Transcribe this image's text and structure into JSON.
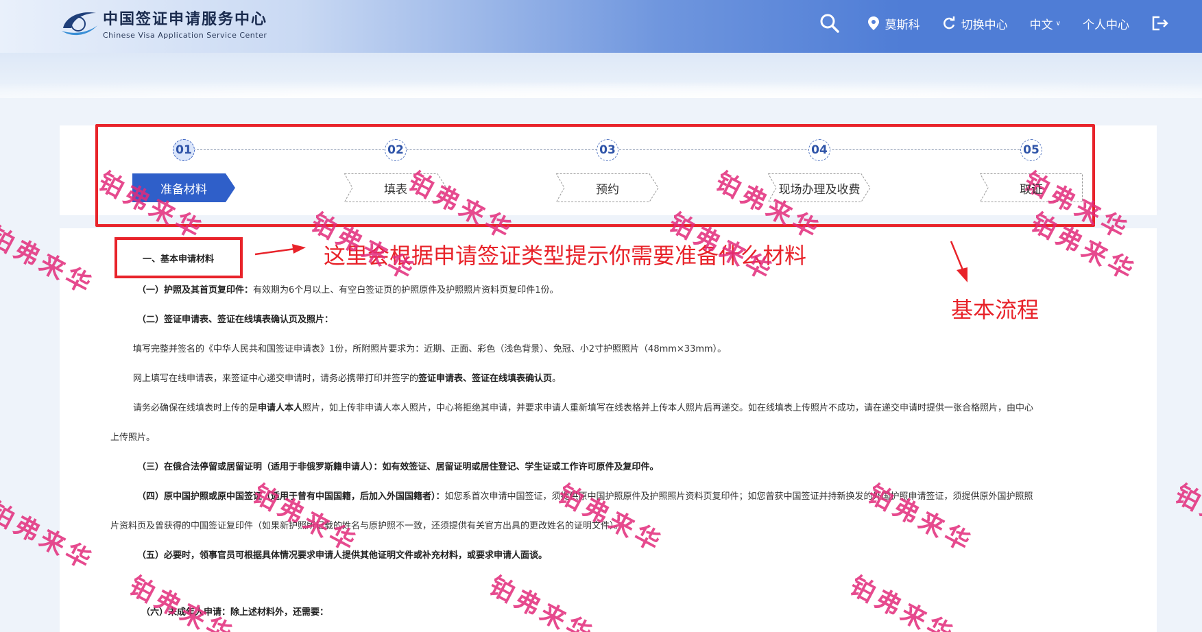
{
  "header": {
    "logo_cn": "中国签证申请服务中心",
    "logo_en": "Chinese Visa Application Service Center",
    "nav": {
      "location": "莫斯科",
      "switch_center": "切换中心",
      "language": "中文",
      "personal_center": "个人中心"
    }
  },
  "steps": [
    {
      "num": "01",
      "label": "准备材料",
      "active": true
    },
    {
      "num": "02",
      "label": "填表",
      "active": false
    },
    {
      "num": "03",
      "label": "预约",
      "active": false
    },
    {
      "num": "04",
      "label": "现场办理及收费",
      "active": false
    },
    {
      "num": "05",
      "label": "取证",
      "active": false
    }
  ],
  "content": {
    "section_title": "一、基本申请材料",
    "p1_bold": "（一）护照及其首页复印件：",
    "p1_text": "有效期为6个月以上、有空白签证页的护照原件及护照照片资料页复印件1份。",
    "p2_bold": "（二）签证申请表、签证在线填表确认页及照片：",
    "p3_text": "填写完整并签名的《中华人民共和国签证申请表》1份，所附照片要求为：近期、正面、彩色（浅色背景）、免冠、小2寸护照照片（48mm×33mm）。",
    "p4_pre": "网上填写在线申请表，来签证中心递交申请时，请务必携带打印并签字的",
    "p4_bold": "签证申请表、签证在线填表确认页",
    "p4_post": "。",
    "p5_pre": "请务必确保在线填表时上传的是",
    "p5_bold": "申请人本人",
    "p5_post": "照片，如上传非申请人本人照片，中心将拒绝其申请，并要求申请人重新填写在线表格并上传本人照片后再递交。如在线填表上传照片不成功，请在递交申请时提供一张合格照片，由中心",
    "p5_cont": "上传照片。",
    "p6_bold": "（三）在俄合法停留或居留证明（适用于非俄罗斯籍申请人）：如有效签证、居留证明或居住登记、学生证或工作许可原件及复印件。",
    "p7_bold": "（四）原中国护照或原中国签证（适用于曾有中国国籍，后加入外国国籍者）：",
    "p7_text": "如您系首次申请中国签证，须提供原中国护照原件及护照照片资料页复印件；如您曾获中国签证并持新换发的外国护照申请签证，须提供原外国护照照",
    "p7_cont": "片资料页及曾获得的中国签证复印件（如果新护照所记载的姓名与原护照不一致，还须提供有关官方出具的更改姓名的证明文件）。",
    "p8_bold": "（五）必要时，领事官员可根据具体情况要求申请人提供其他证明文件或补充材料，或要求申请人面谈。",
    "p9_bold": "（六）未成年人申请：除上述材料外，还需要："
  },
  "annotations": {
    "materials_hint": "这里会根据申请签证类型提示你需要准备什么材料",
    "basic_process": "基本流程"
  },
  "watermark": "铂弗来华",
  "colors": {
    "accent": "#2f5fc9",
    "annotation_red": "#e8232a",
    "watermark_pink": "#e22a7a"
  }
}
